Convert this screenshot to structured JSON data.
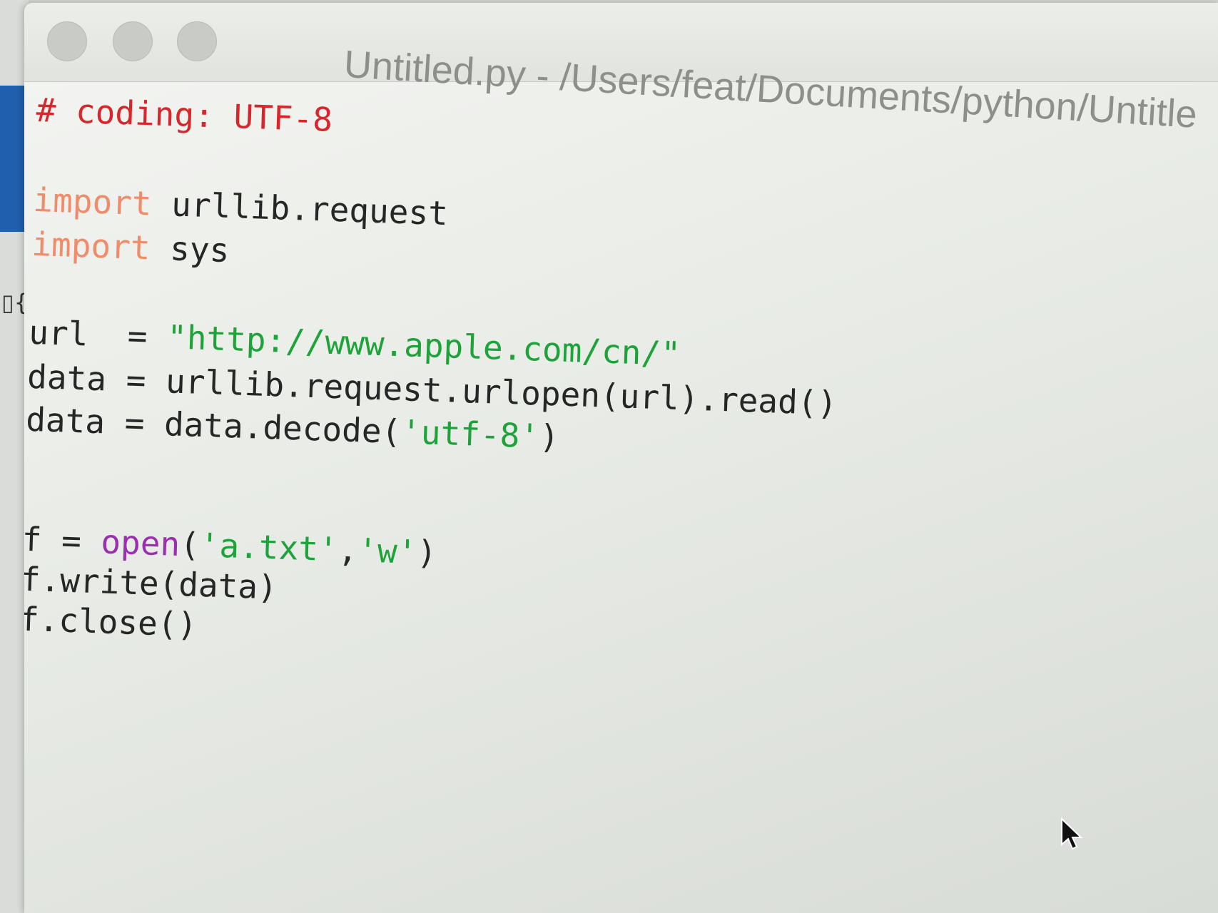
{
  "window": {
    "title": "Untitled.py - /Users/feat/Documents/python/Untitle"
  },
  "editor": {
    "lines": [
      [
        {
          "t": "# coding: UTF-8",
          "c": "comment"
        }
      ],
      [
        {
          "t": "import",
          "c": "keyword"
        },
        {
          "t": " urllib.request",
          "c": "plain"
        }
      ],
      [
        {
          "t": "import",
          "c": "keyword"
        },
        {
          "t": " sys",
          "c": "plain"
        }
      ],
      [
        {
          "t": "url  = ",
          "c": "plain"
        },
        {
          "t": "\"http://www.apple.com/cn/\"",
          "c": "string"
        }
      ],
      [
        {
          "t": "data = urllib.request.urlopen(url).read()",
          "c": "plain"
        }
      ],
      [
        {
          "t": "data = data.decode(",
          "c": "plain"
        },
        {
          "t": "'utf-8'",
          "c": "string"
        },
        {
          "t": ")",
          "c": "plain"
        }
      ],
      [
        {
          "t": "f = ",
          "c": "plain"
        },
        {
          "t": "open",
          "c": "builtin"
        },
        {
          "t": "(",
          "c": "plain"
        },
        {
          "t": "'a.txt'",
          "c": "string"
        },
        {
          "t": ",",
          "c": "plain"
        },
        {
          "t": "'w'",
          "c": "string"
        },
        {
          "t": ")",
          "c": "plain"
        }
      ],
      [
        {
          "t": "f.write(data)",
          "c": "plain"
        }
      ],
      [
        {
          "t": "f.close()",
          "c": "plain"
        }
      ]
    ]
  },
  "colors": {
    "comment": "#d8262a",
    "keyword": "#f08c6a",
    "string": "#1ea33b",
    "builtin": "#9c2fb0",
    "plain": "#262626"
  },
  "icons": {
    "traffic_lights": [
      "close-icon",
      "minimize-icon",
      "zoom-icon"
    ],
    "pointer": "mouse-pointer-icon"
  }
}
